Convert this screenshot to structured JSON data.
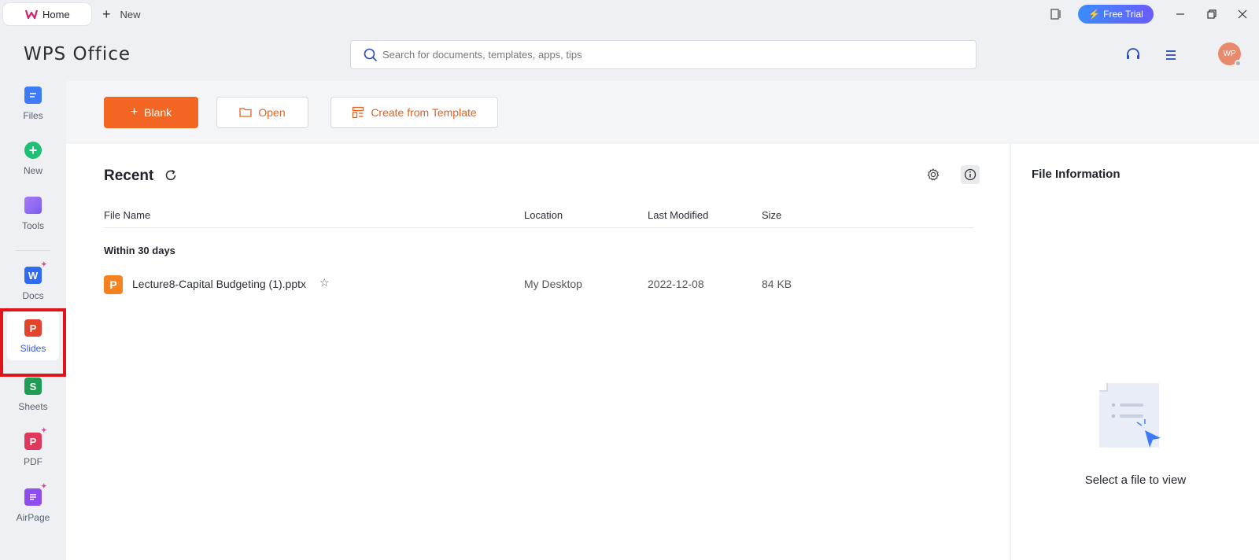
{
  "titlebar": {
    "home_tab": "Home",
    "new_tab": "New",
    "free_trial": "Free Trial"
  },
  "header": {
    "brand": "WPS Office",
    "search_placeholder": "Search for documents, templates, apps, tips",
    "avatar_initials": "WP"
  },
  "sidebar": {
    "items": [
      {
        "label": "Files",
        "icon": "files-icon"
      },
      {
        "label": "New",
        "icon": "new-icon"
      },
      {
        "label": "Tools",
        "icon": "tools-icon"
      },
      {
        "label": "Docs",
        "icon": "docs-icon"
      },
      {
        "label": "Slides",
        "icon": "slides-icon"
      },
      {
        "label": "Sheets",
        "icon": "sheets-icon"
      },
      {
        "label": "PDF",
        "icon": "pdf-icon"
      },
      {
        "label": "AirPage",
        "icon": "airpage-icon"
      }
    ],
    "active": "Slides"
  },
  "actions": {
    "blank": "Blank",
    "open": "Open",
    "template": "Create from Template"
  },
  "recent": {
    "title": "Recent",
    "columns": {
      "name": "File Name",
      "location": "Location",
      "modified": "Last Modified",
      "size": "Size"
    },
    "group": "Within 30 days",
    "files": [
      {
        "name": "Lecture8-Capital Budgeting (1).pptx",
        "location": "My Desktop",
        "modified": "2022-12-08",
        "size": "84 KB"
      }
    ]
  },
  "file_info": {
    "title": "File Information",
    "empty_text": "Select a file to view"
  },
  "colors": {
    "accent_orange": "#f26522",
    "active_blue": "#3b5bdb",
    "highlight_red": "#e0131b"
  }
}
